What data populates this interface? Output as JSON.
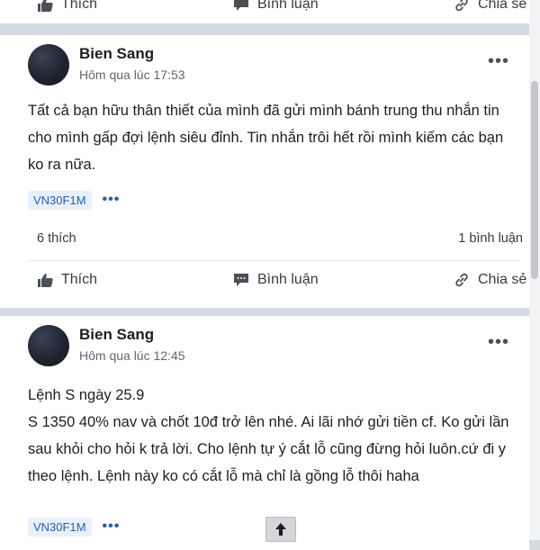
{
  "previous_post": {
    "like_label": "Thích",
    "comment_label": "Bình luận",
    "share_label": "Chia sẻ"
  },
  "posts": [
    {
      "author": "Bien Sang",
      "time": "Hôm qua lúc 17:53",
      "text": "Tất cả bạn hữu thân thiết của mình đã gửi mình bánh trung thu nhắn tin cho mình gấp đợi lệnh siêu đỉnh. Tin nhắn trôi hết rồi mình kiếm các bạn ko ra nữa.",
      "tag": "VN30F1M",
      "likes": "6 thích",
      "comments": "1 bình luận",
      "like_label": "Thích",
      "comment_label": "Bình luận",
      "share_label": "Chia sẻ"
    },
    {
      "author": "Bien Sang",
      "time": "Hôm qua lúc 12:45",
      "text_lines": [
        "Lệnh S ngày 25.9",
        "S 1350 40% nav và chốt 10đ trở lên nhé. Ai lãi nhớ gửi tiền cf. Ko gửi lần sau khỏi cho hỏi k trả lời. Cho lệnh tự ý cắt lỗ cũng đừng hỏi luôn.cứ đi y theo lệnh. Lệnh này ko có cắt lỗ mà chỉ là gồng lỗ thôi haha"
      ],
      "tag": "VN30F1M"
    }
  ],
  "icons": {
    "like": "thumb-up-icon",
    "comment": "comment-icon",
    "share": "link-icon",
    "more": "more-icon",
    "scroll_top": "arrow-up-icon"
  }
}
